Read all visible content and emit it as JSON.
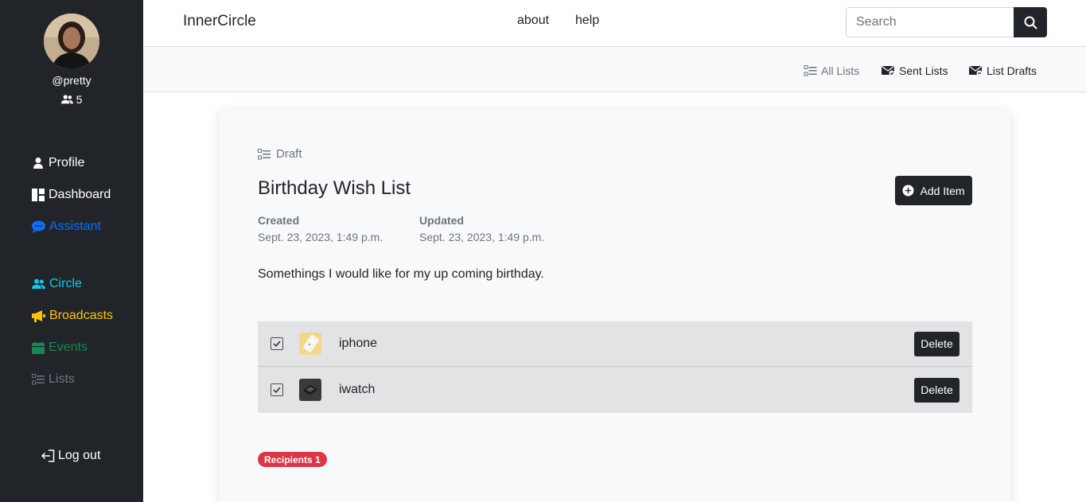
{
  "sidebar": {
    "username": "@pretty",
    "circle_count": "5",
    "nav": {
      "profile": "Profile",
      "dashboard": "Dashboard",
      "assistant": "Assistant",
      "circle": "Circle",
      "broadcasts": "Broadcasts",
      "events": "Events",
      "lists": "Lists"
    },
    "logout": "Log out"
  },
  "topbar": {
    "brand": "InnerCircle",
    "links": {
      "about": "about",
      "help": "help"
    },
    "search_placeholder": "Search"
  },
  "subnav": {
    "all_lists": "All Lists",
    "sent_lists": "Sent Lists",
    "list_drafts": "List Drafts"
  },
  "list": {
    "status": "Draft",
    "title": "Birthday Wish List",
    "add_item_label": "Add Item",
    "created_label": "Created",
    "created_value": "Sept. 23, 2023, 1:49 p.m.",
    "updated_label": "Updated",
    "updated_value": "Sept. 23, 2023, 1:49 p.m.",
    "description": "Somethings I would like for my up coming birthday.",
    "items": [
      {
        "name": "iphone",
        "checked": true,
        "delete_label": "Delete"
      },
      {
        "name": "iwatch",
        "checked": true,
        "delete_label": "Delete"
      }
    ],
    "recipients_label": "Recipients 1"
  },
  "colors": {
    "sidebar_bg": "#212529",
    "assistant": "#0d6efd",
    "circle": "#0dcaf0",
    "broadcasts": "#ffc107",
    "events": "#198754",
    "lists": "#6c757d",
    "badge": "#dc3545"
  }
}
